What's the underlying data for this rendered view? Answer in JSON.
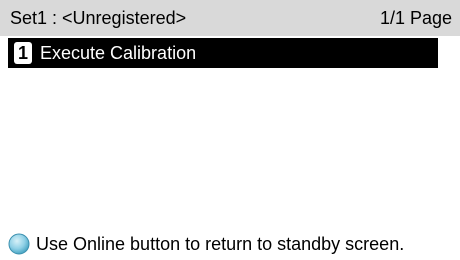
{
  "header": {
    "title": "Set1 : <Unregistered>",
    "page_indicator": "1/1 Page"
  },
  "menu": {
    "items": [
      {
        "number": "1",
        "label": "Execute Calibration",
        "selected": true
      }
    ]
  },
  "footer": {
    "icon": "online-button-icon",
    "message": "Use Online button to return to standby screen."
  },
  "colors": {
    "header_bg": "#d9d9d9",
    "selected_bg": "#000000",
    "selected_fg": "#ffffff",
    "online_icon": "#6fc3dc"
  }
}
